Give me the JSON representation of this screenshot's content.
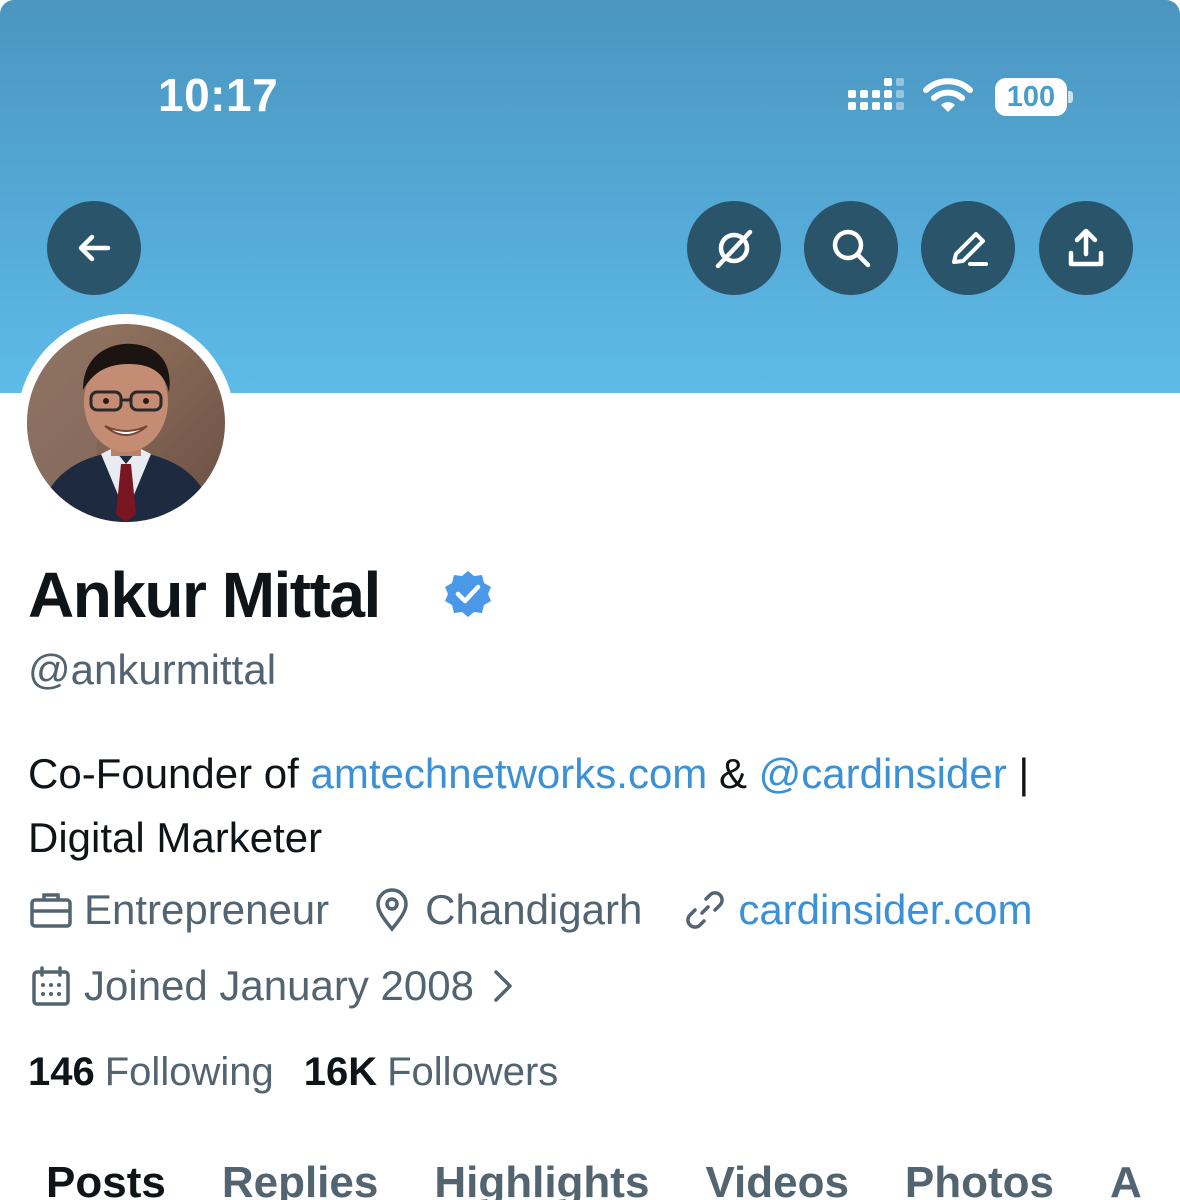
{
  "status_bar": {
    "time": "10:17",
    "battery": "100"
  },
  "profile": {
    "name": "Ankur Mittal",
    "handle": "@ankurmittal",
    "bio_prefix": "Co-Founder of ",
    "bio_link": "amtechnetworks.com",
    "bio_amp": " & ",
    "bio_mention": "@cardinsider",
    "bio_separator": " |",
    "bio_line2": "Digital Marketer",
    "profession": "Entrepreneur",
    "location": "Chandigarh",
    "website": "cardinsider.com",
    "joined": "Joined January 2008",
    "following_count": "146",
    "following_label": "Following",
    "followers_count": "16K",
    "followers_label": "Followers"
  },
  "tabs": [
    "Posts",
    "Replies",
    "Highlights",
    "Videos",
    "Photos",
    "A"
  ],
  "colors": {
    "banner_top": "#4a96c0",
    "banner_bottom": "#5ebbe8",
    "action_button": "#29546a",
    "link": "#3b90d6",
    "verified": "#4a99e9"
  },
  "icons": {
    "back": "arrow-left-icon",
    "grok": "grok-icon",
    "search": "search-icon",
    "edit": "edit-icon",
    "share": "share-icon"
  }
}
